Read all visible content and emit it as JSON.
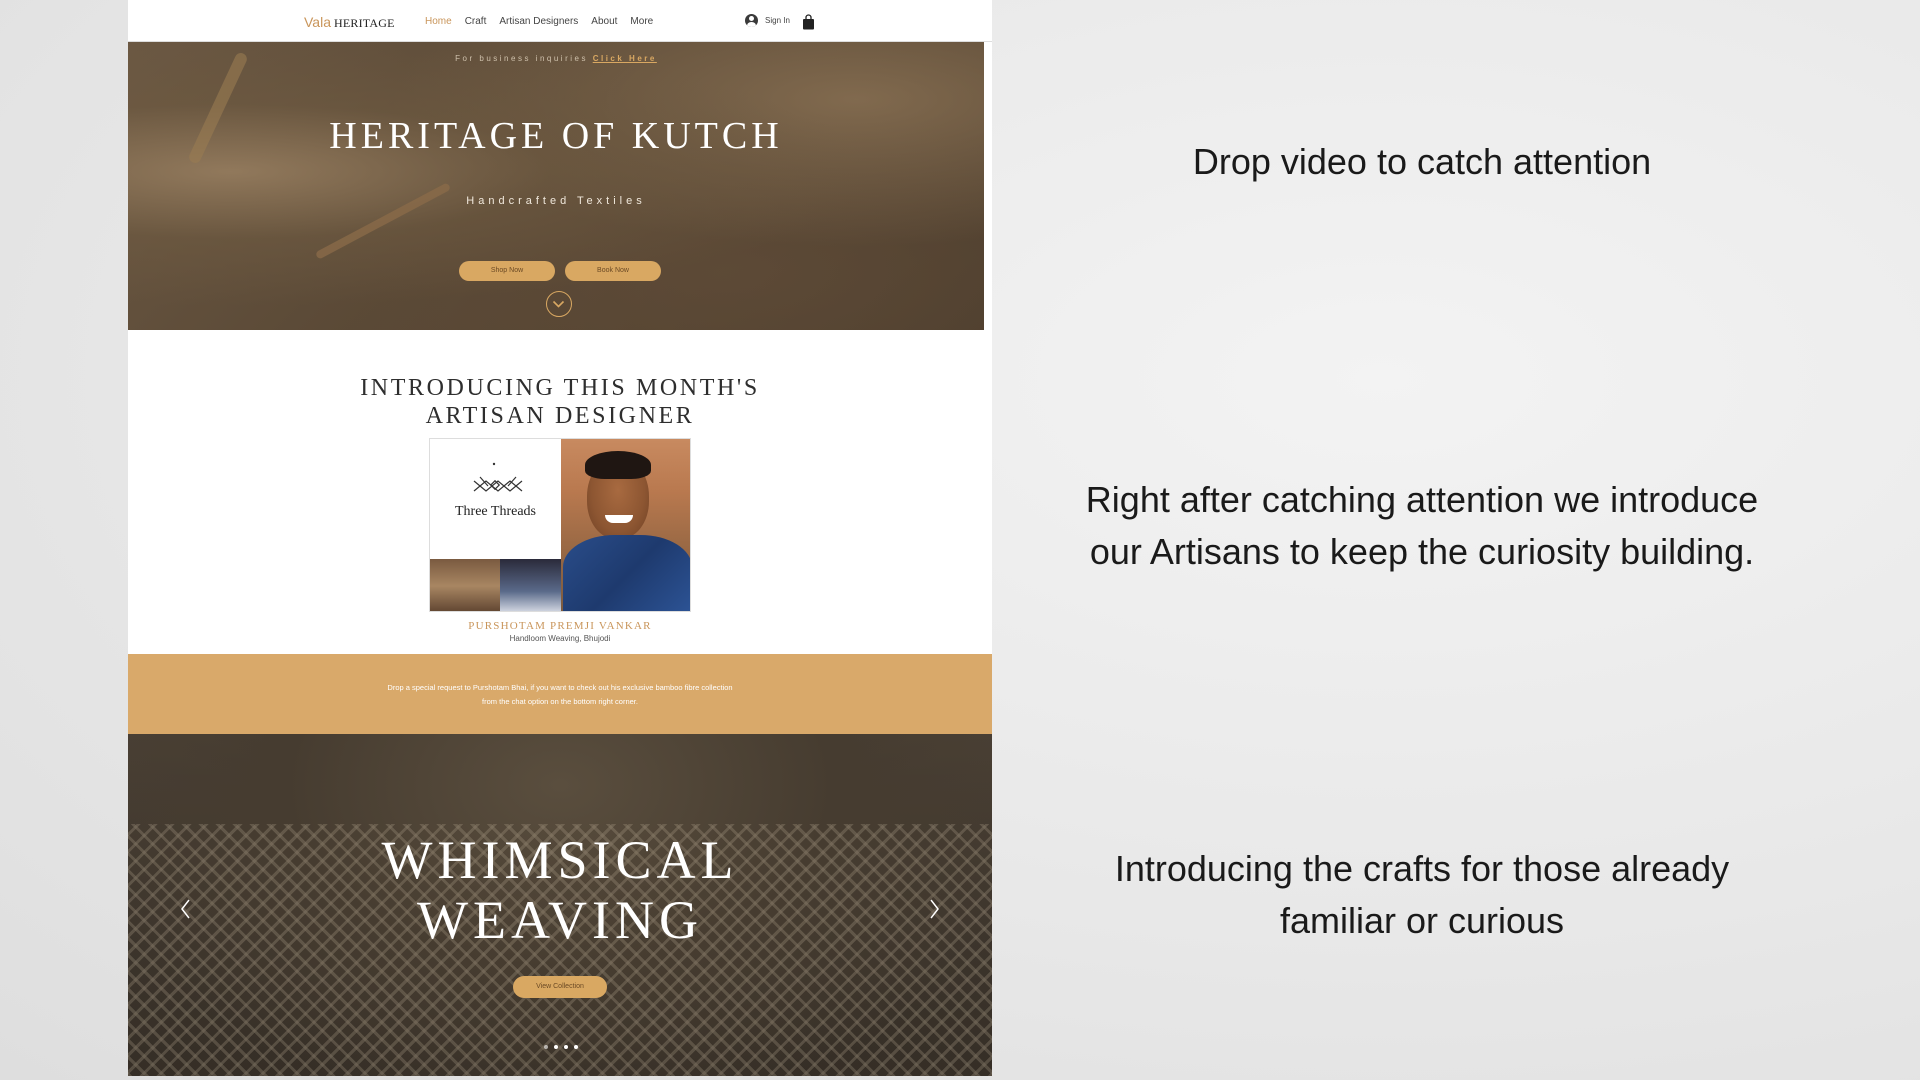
{
  "nav": {
    "logo_brand": "Vala",
    "logo_word": "HERITAGE",
    "items": [
      {
        "label": "Home",
        "active": true
      },
      {
        "label": "Craft",
        "active": false
      },
      {
        "label": "Artisan Designers",
        "active": false
      },
      {
        "label": "About",
        "active": false
      },
      {
        "label": "More",
        "active": false
      }
    ],
    "signin_label": "Sign In",
    "avatar_icon": "user-avatar-icon",
    "cart_icon": "shopping-bag-icon"
  },
  "hero": {
    "inquiry_text": "For business inquiries",
    "inquiry_link": "Click Here",
    "title": "HERITAGE OF KUTCH",
    "subtitle": "Handcrafted Textiles",
    "shop_button": "Shop Now",
    "book_button": "Book Now",
    "scroll_icon": "chevron-down-icon"
  },
  "artisan": {
    "title_line1": "INTRODUCING THIS MONTH'S",
    "title_line2": "ARTISAN DESIGNER",
    "brand_logo": "Three Threads",
    "name": "PURSHOTAM PREMJI VANKAR",
    "craft": "Handloom Weaving, Bhujodi"
  },
  "band": {
    "line1": "Drop a special request to Purshotam Bhai, if you want to check out his exclusive bamboo fibre collection",
    "line2": "from the chat option on the bottom right corner."
  },
  "weaving": {
    "title_line1": "WHIMSICAL",
    "title_line2": "WEAVING",
    "button": "View Collection",
    "prev_icon": "chevron-left-icon",
    "next_icon": "chevron-right-icon"
  },
  "notes": {
    "note1": "Drop video to catch attention",
    "note2_line1": "Right after catching attention we introduce",
    "note2_line2": "our Artisans to keep the curiosity building.",
    "note3_line1": "Introducing the crafts for those already",
    "note3_line2": "familiar or curious"
  },
  "colors": {
    "accent": "#d9a862",
    "band": "#d9a96a",
    "text_dark": "#1a1a1a"
  }
}
